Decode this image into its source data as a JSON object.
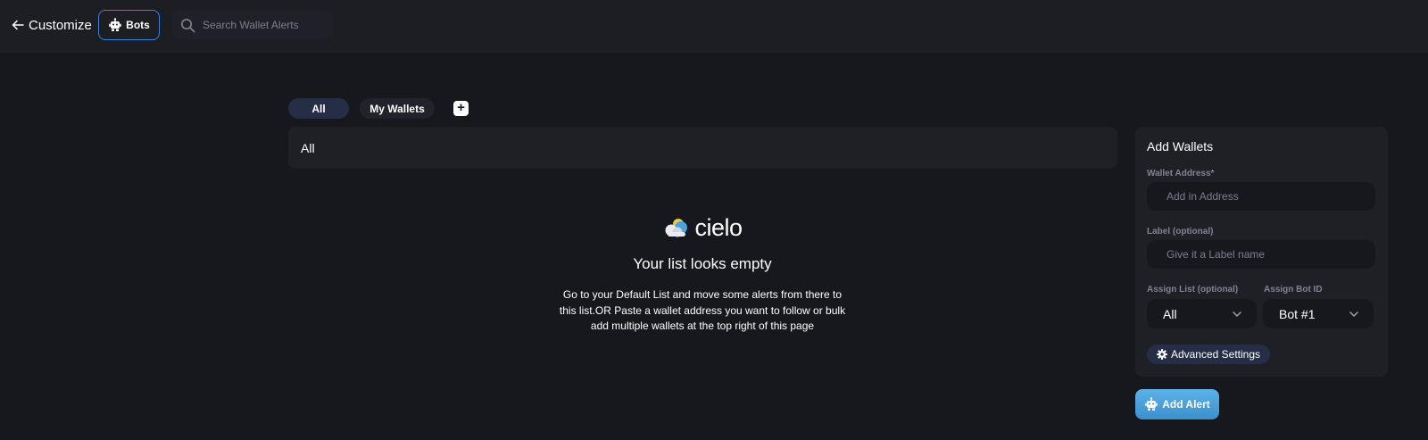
{
  "header": {
    "back_label": "Customize",
    "bots_label": "Bots",
    "search_placeholder": "Search Wallet Alerts"
  },
  "tabs": {
    "items": [
      {
        "label": "All",
        "active": true
      },
      {
        "label": "My Wallets",
        "active": false
      }
    ],
    "add_label": "+"
  },
  "list": {
    "header": "All"
  },
  "empty_state": {
    "logo_text": "cielo",
    "title": "Your list looks empty",
    "body": "Go to your Default List and move some alerts from there to this list.OR Paste a wallet address you want to follow or bulk add multiple wallets at the top right of this page"
  },
  "add_wallets": {
    "title": "Add Wallets",
    "wallet_address_label": "Wallet Address*",
    "wallet_address_placeholder": "Add in Address",
    "label_label": "Label (optional)",
    "label_placeholder": "Give it a Label name",
    "assign_list_label": "Assign List (optional)",
    "assign_list_value": "All",
    "assign_bot_label": "Assign Bot ID",
    "assign_bot_value": "Bot #1",
    "advanced_settings_label": "Advanced Settings",
    "add_alert_label": "Add Alert"
  },
  "icons": {
    "back": "arrow-left-icon",
    "bot": "robot-icon",
    "search": "search-icon",
    "chevron": "chevron-down-icon",
    "gear": "gear-icon",
    "logo": "cielo-cloud-logo"
  },
  "colors": {
    "background": "#17181d",
    "topbar": "#1d1e24",
    "card": "#1f2026",
    "accent_border": "#3e7fd6",
    "tab_active": "#262d47",
    "add_alert": "#4aa3df"
  }
}
